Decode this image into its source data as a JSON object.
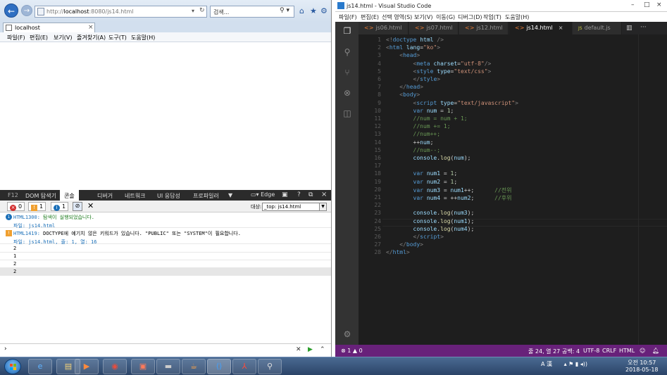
{
  "ie": {
    "address_prefix": "http://",
    "address_host": "localhost",
    "address_rest": ":8080/js14.html",
    "search_placeholder": "검색...",
    "tab_title": "localhost",
    "menu": [
      "파일(F)",
      "편집(E)",
      "보기(V)",
      "즐겨찾기(A)",
      "도구(T)",
      "도움말(H)"
    ],
    "f12": {
      "label": "F12",
      "tabs": [
        "DOM 탐색기",
        "콘솔",
        "디버거",
        "네트워크",
        "UI 응답성",
        "프로파일러"
      ],
      "active_tab": "콘솔",
      "emulation": "Edge",
      "errors": "0",
      "warnings": "1",
      "messages": "1",
      "target_label": "대상:",
      "target_value": "_top: js14.html",
      "console": [
        {
          "code": "HTML1300:",
          "text": " 탐색이 실행되었습니다.",
          "sub": "파일: js14.html",
          "level": "info"
        },
        {
          "code": "HTML1419:",
          "text": " DOCTYPE에 예기치 않은 키워드가 있습니다. \"PUBLIC\" 또는 \"SYSTEM\"이 필요합니다.",
          "sub": "파일: js14.html, 줄: 1, 열: 16",
          "level": "warning"
        },
        {
          "text": "2"
        },
        {
          "text": "1"
        },
        {
          "text": "2"
        },
        {
          "text": "2"
        }
      ],
      "prompt": "›"
    }
  },
  "vscode": {
    "title": "js14.html - Visual Studio Code",
    "menu": [
      "파일(F)",
      "편집(E)",
      "선택 영역(S)",
      "보기(V)",
      "이동(G)",
      "디버그(D)",
      "작업(T)",
      "도움말(H)"
    ],
    "tabs": [
      {
        "name": "js06.html",
        "type": "html"
      },
      {
        "name": "js07.html",
        "type": "html"
      },
      {
        "name": "js12.html",
        "type": "html"
      },
      {
        "name": "js14.html",
        "type": "html",
        "active": true
      },
      {
        "name": "default.js",
        "type": "js"
      }
    ],
    "status": {
      "problems": "⊗ 1 ▲ 0",
      "position": "줄 24, 열 27",
      "spaces": "공백: 4",
      "encoding": "UTF-8",
      "eol": "CRLF",
      "language": "HTML"
    }
  },
  "taskbar": {
    "clock_time": "오전 10:57",
    "clock_date": "2018-05-18",
    "ime": "A 漢"
  },
  "colors": {
    "vscode_status": "#68217a",
    "editor_bg": "#1e1e1e",
    "activity_bar": "#333333"
  }
}
